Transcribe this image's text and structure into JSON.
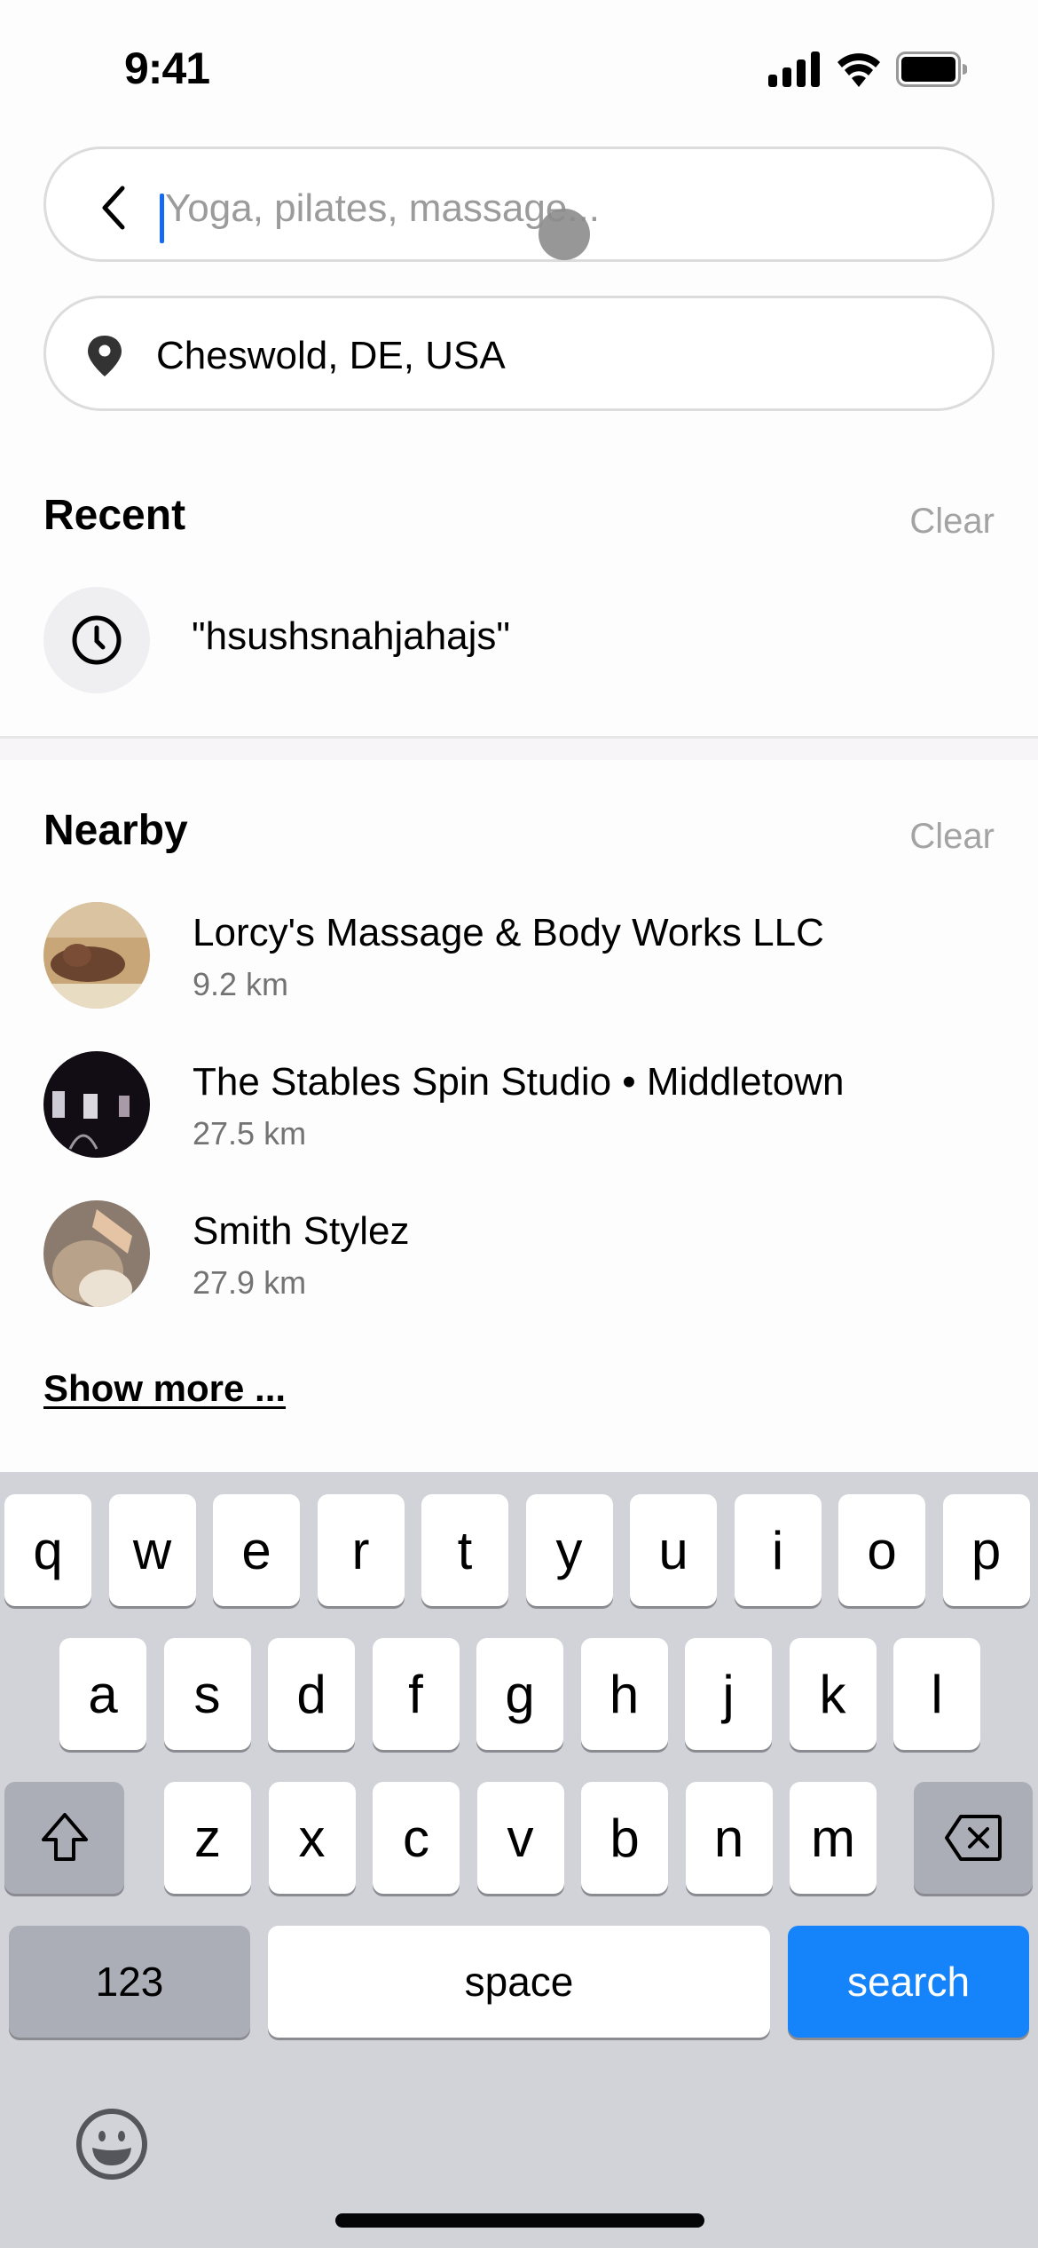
{
  "status_bar": {
    "time": "9:41",
    "icons": [
      "cellular-signal-icon",
      "wifi-icon",
      "battery-icon"
    ]
  },
  "search": {
    "placeholder": "Yoga, pilates, massage...",
    "value": "",
    "back_icon": "chevron-left-icon"
  },
  "location": {
    "value": "Cheswold, DE, USA",
    "icon": "map-pin-icon"
  },
  "recent": {
    "title": "Recent",
    "clear_label": "Clear",
    "items": [
      {
        "label": "\"hsushsnahjahajs\"",
        "icon": "clock-icon"
      }
    ]
  },
  "nearby": {
    "title": "Nearby",
    "clear_label": "Clear",
    "items": [
      {
        "name": "Lorcy's Massage & Body Works LLC",
        "distance": "9.2 km"
      },
      {
        "name": "The Stables Spin Studio • Middletown",
        "distance": "27.5 km"
      },
      {
        "name": "Smith Stylez",
        "distance": "27.9 km"
      }
    ],
    "show_more_label": "Show more ..."
  },
  "keyboard": {
    "row1": [
      "q",
      "w",
      "e",
      "r",
      "t",
      "y",
      "u",
      "i",
      "o",
      "p"
    ],
    "row2": [
      "a",
      "s",
      "d",
      "f",
      "g",
      "h",
      "j",
      "k",
      "l"
    ],
    "row3": [
      "z",
      "x",
      "c",
      "v",
      "b",
      "n",
      "m"
    ],
    "numbers_label": "123",
    "space_label": "space",
    "return_label": "search",
    "accent_color": "#1583f9"
  }
}
